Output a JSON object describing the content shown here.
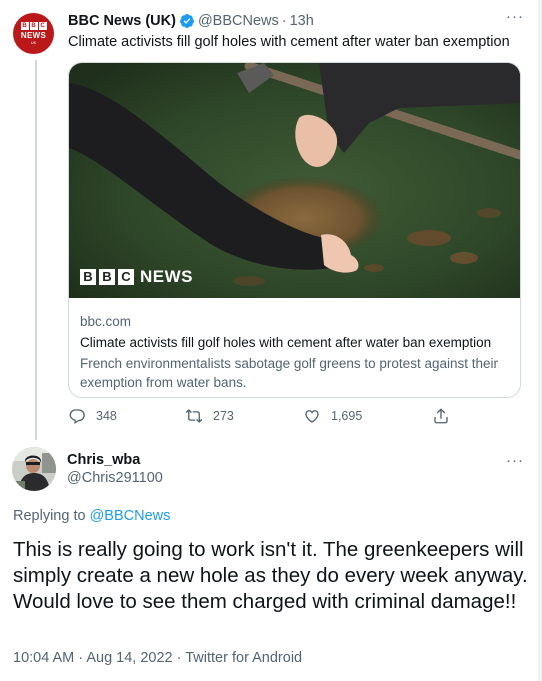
{
  "parent_tweet": {
    "avatar": {
      "lines": [
        "B",
        "B",
        "C"
      ],
      "news": "NEWS",
      "region": "UK"
    },
    "display_name": "BBC News (UK)",
    "handle": "@BBCNews",
    "separator": "·",
    "time": "13h",
    "text": "Climate activists fill golf holes with cement after water ban exemption",
    "card": {
      "logo_letters": [
        "B",
        "B",
        "C"
      ],
      "logo_word": "NEWS",
      "domain": "bbc.com",
      "title": "Climate activists fill golf holes with cement after water ban exemption",
      "description": "French environmentalists sabotage golf greens to protest against their exemption from water bans."
    },
    "actions": {
      "reply_count": "348",
      "retweet_count": "273",
      "like_count": "1,695"
    },
    "icons": {
      "reply": "reply-icon",
      "retweet": "retweet-icon",
      "like": "heart-icon",
      "share": "share-icon",
      "more": "more-icon",
      "verified": "verified-badge-icon"
    }
  },
  "reply_tweet": {
    "display_name": "Chris_wba",
    "handle": "@Chris291100",
    "replying_prefix": "Replying to",
    "replying_to": "@BBCNews",
    "text": "This is really going to work isn't it. The greenkeepers will simply create a new hole as they do every week anyway. Would love to see them charged with criminal damage!!",
    "meta": "10:04 AM · Aug 14, 2022 · Twitter for Android"
  },
  "colors": {
    "text": "#0f1419",
    "secondary": "#536471",
    "accent": "#1d9bf0",
    "bbc_red": "#bb1919",
    "border": "#cfd9de"
  }
}
